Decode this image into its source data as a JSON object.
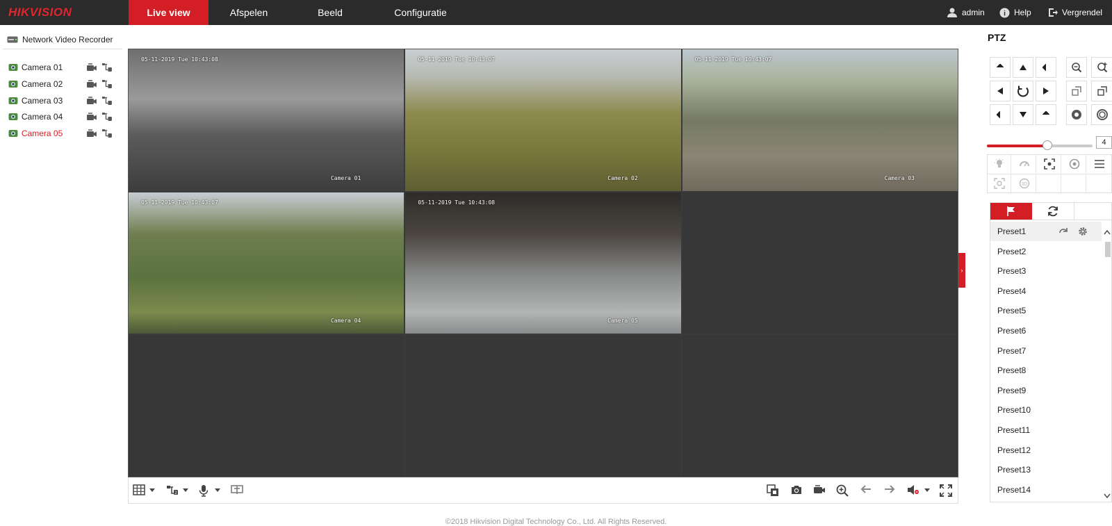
{
  "app": {
    "logo_text": "HIKVISION",
    "accent": "#d41e25"
  },
  "nav": {
    "items": [
      {
        "label": "Live view",
        "active": true
      },
      {
        "label": "Afspelen",
        "active": false
      },
      {
        "label": "Beeld",
        "active": false
      },
      {
        "label": "Configuratie",
        "active": false
      }
    ],
    "user": "admin",
    "help": "Help",
    "logout": "Vergrendel"
  },
  "tree": {
    "root": "Network Video Recorder",
    "cameras": [
      {
        "label": "Camera 01",
        "selected": false
      },
      {
        "label": "Camera 02",
        "selected": false
      },
      {
        "label": "Camera 03",
        "selected": false
      },
      {
        "label": "Camera 04",
        "selected": false
      },
      {
        "label": "Camera 05",
        "selected": true
      }
    ]
  },
  "grid": {
    "tiles": [
      {
        "osd_time": "05-11-2019 Tue 10:43:08",
        "osd_name": "Camera 01",
        "active": false,
        "has_feed": true
      },
      {
        "osd_time": "05-11-2019 Tue 10:43:07",
        "osd_name": "Camera 02",
        "active": false,
        "has_feed": true
      },
      {
        "osd_time": "05-11-2019 Tue 10:43:07",
        "osd_name": "Camera 03",
        "active": false,
        "has_feed": true
      },
      {
        "osd_time": "05-11-2019 Tue 10:43:07",
        "osd_name": "Camera 04",
        "active": false,
        "has_feed": true
      },
      {
        "osd_time": "05-11-2019 Tue 10:43:08",
        "osd_name": "Camera 05",
        "active": true,
        "has_feed": true
      },
      {
        "osd_time": "",
        "osd_name": "",
        "active": false,
        "has_feed": false
      },
      {
        "osd_time": "",
        "osd_name": "",
        "active": false,
        "has_feed": false
      },
      {
        "osd_time": "",
        "osd_name": "",
        "active": false,
        "has_feed": false
      },
      {
        "osd_time": "",
        "osd_name": "",
        "active": false,
        "has_feed": false
      }
    ]
  },
  "footer": {
    "copyright": "©2018 Hikvision Digital Technology Co., Ltd. All Rights Reserved."
  },
  "ptz": {
    "title": "PTZ",
    "speed": 4,
    "speed_max": 7,
    "presets": [
      "Preset1",
      "Preset2",
      "Preset3",
      "Preset4",
      "Preset5",
      "Preset6",
      "Preset7",
      "Preset8",
      "Preset9",
      "Preset10",
      "Preset11",
      "Preset12",
      "Preset13",
      "Preset14"
    ],
    "highlighted_preset": 0
  }
}
